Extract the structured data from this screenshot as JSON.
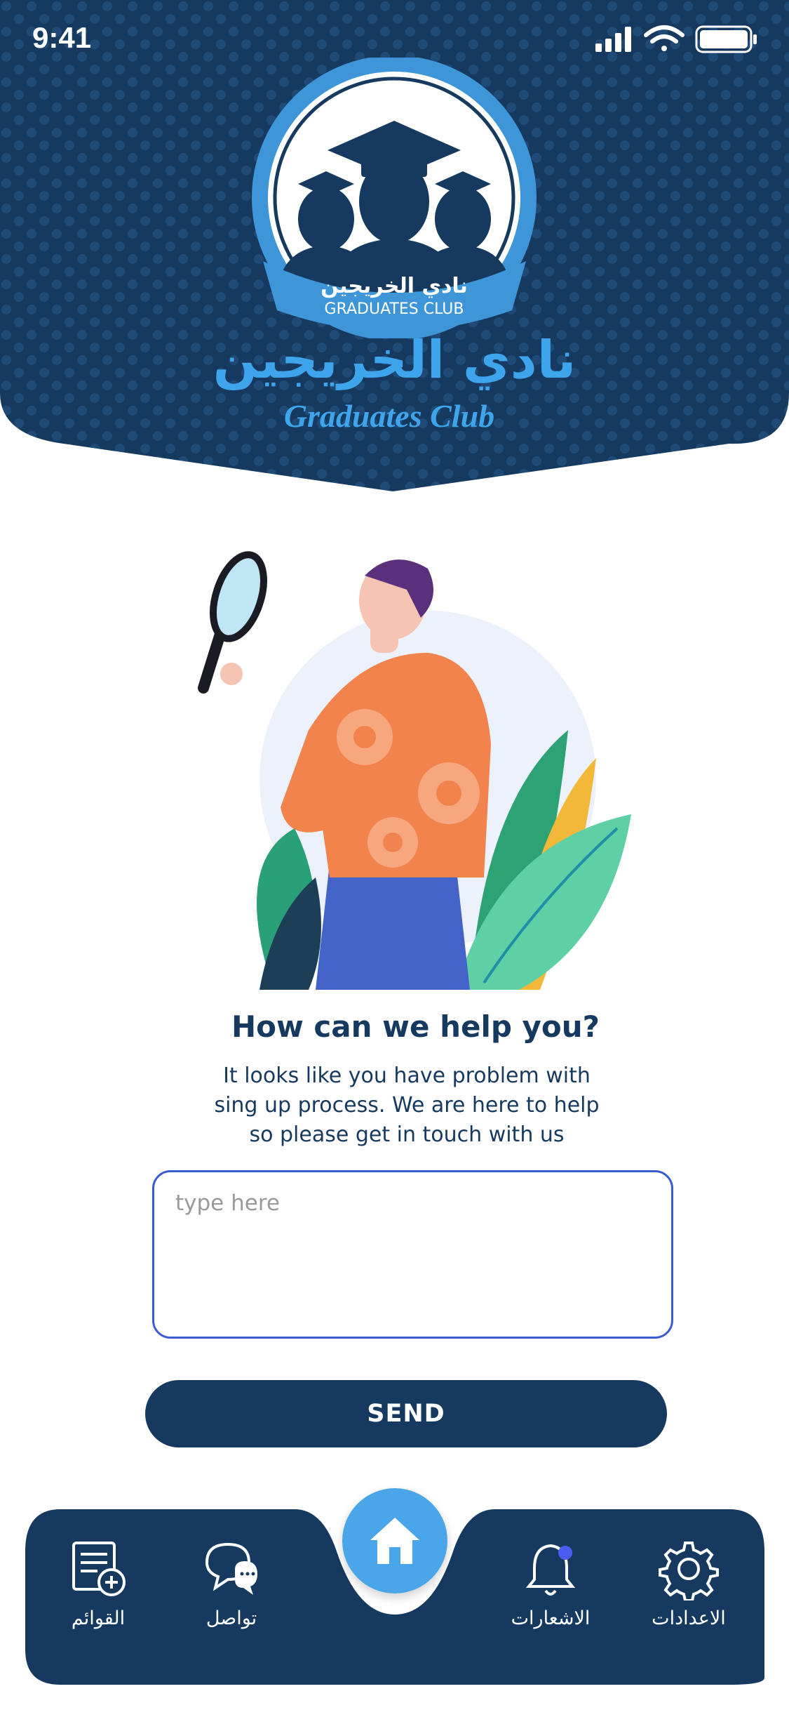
{
  "status_bar": {
    "time": "9:41"
  },
  "brand": {
    "arabic_name": "نادي الخريجين",
    "english_name": "Graduates Club",
    "logo_arabic": "نادي الخريجين",
    "logo_english": "GRADUATES CLUB"
  },
  "help": {
    "title": "How can we help you?",
    "description": "It looks like you have problem with sing up process. We are here to help so please get in touch with us"
  },
  "message": {
    "placeholder": "type here",
    "value": ""
  },
  "send_button": {
    "label": "SEND"
  },
  "nav": {
    "lists": {
      "label": "القوائم",
      "icon": "list-add-icon"
    },
    "contact": {
      "label": "تواصل",
      "icon": "chat-bubbles-icon"
    },
    "home": {
      "icon": "home-icon"
    },
    "notifications": {
      "label": "الاشعارات",
      "icon": "bell-icon"
    },
    "settings": {
      "label": "الاعدادات",
      "icon": "gear-icon"
    }
  },
  "colors": {
    "primary_navy": "#163a5f",
    "accent_blue": "#3ea5ec",
    "home_button": "#4aa6e8",
    "input_border": "#3b5bd0",
    "notification_dot": "#4a5cf0"
  }
}
